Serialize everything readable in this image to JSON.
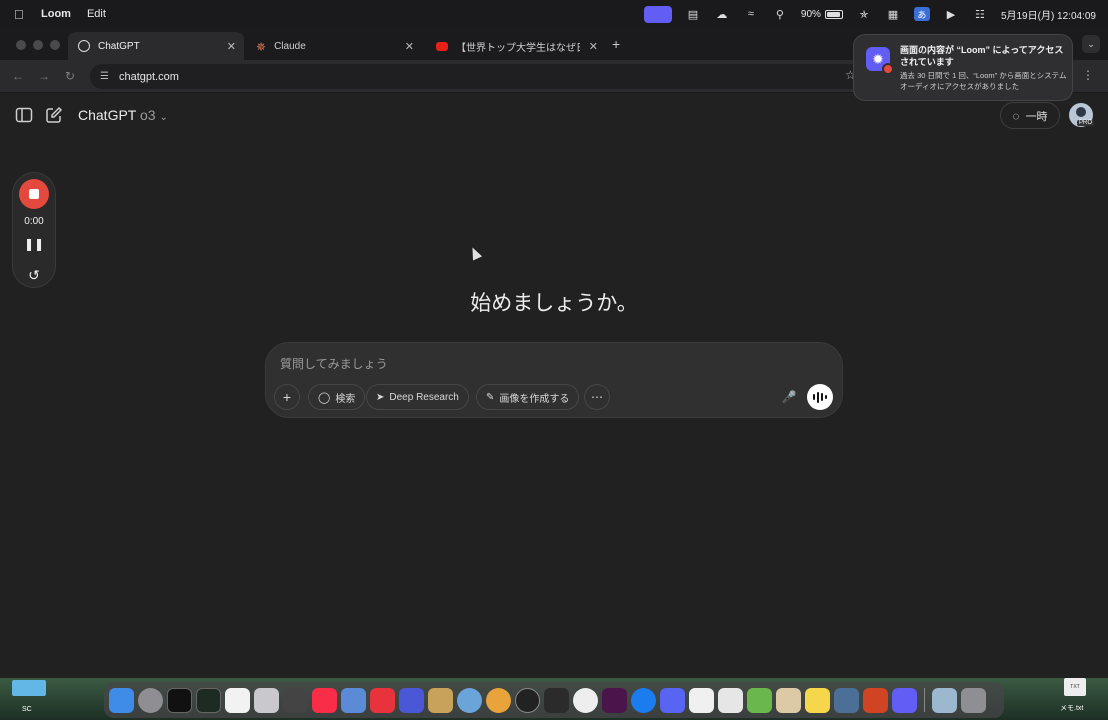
{
  "menubar": {
    "app_name": "Loom",
    "menu_edit": "Edit",
    "battery": "90%",
    "ime": "あ",
    "datetime": "5月19日(月)  12:04:09"
  },
  "browser": {
    "tabs": [
      {
        "label": "ChatGPT",
        "active": true
      },
      {
        "label": "Claude",
        "active": false
      },
      {
        "label": "【世界トップ大学生はなぜ日本が",
        "active": false
      }
    ],
    "url": "chatgpt.com"
  },
  "chatgpt": {
    "model_name": "ChatGPT",
    "model_variant": "o3",
    "temp_chat_label": "一時",
    "avatar_badge": "PRO",
    "heading": "始めましょうか。",
    "composer": {
      "placeholder": "質問してみましょう",
      "search_label": "検索",
      "deep_research_label": "Deep Research",
      "create_image_label": "画像を作成する"
    }
  },
  "recorder": {
    "time": "0:00"
  },
  "notification": {
    "title": "画面の内容が “Loom” によってアクセスされています",
    "body": "過去 30 日間で 1 回、“Loom” から画面とシステムオーディオにアクセスがありました"
  },
  "desktop": {
    "folder_label": "SC",
    "file_label": "メモ.txt",
    "file_icon_text": "TXT"
  },
  "colors": {
    "loom_brand": "#625df5",
    "record_red": "#e3493d",
    "background": "#212121"
  }
}
